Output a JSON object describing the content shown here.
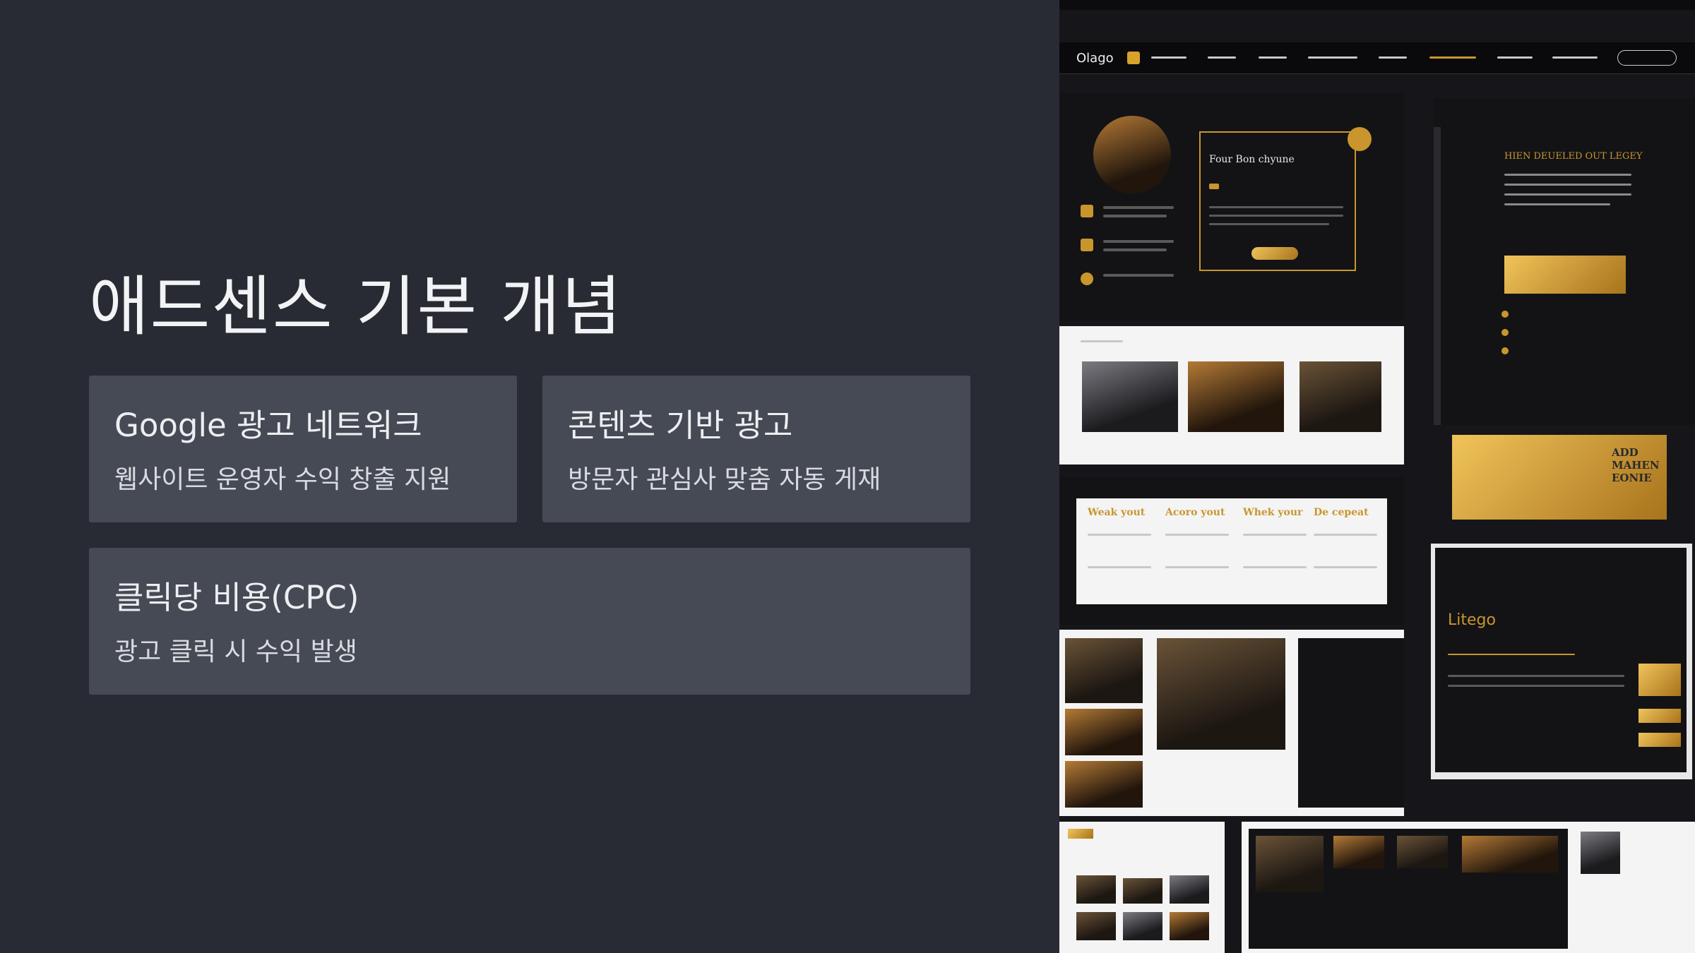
{
  "slide": {
    "title": "애드센스 기본 개념",
    "cards": [
      {
        "title": "Google 광고 네트워크",
        "description": "웹사이트 운영자 수익 창출 지원"
      },
      {
        "title": "콘텐츠 기반 광고",
        "description": "방문자 관심사 맞춤 자동 게재"
      },
      {
        "title": "클릭당 비용(CPC)",
        "description": "광고 클릭 시 수익 발생"
      }
    ]
  },
  "collage": {
    "nav_logo": "Olago",
    "tile_headings": {
      "card_heading": "Four Bon chyune",
      "legacy_heading": "HIEN DEUELED OUT LEGEY",
      "col1": "Weak yout",
      "col2": "Acoro yout",
      "col3": "Whek your",
      "col4": "De cepeat",
      "brand": "Litego",
      "gold_banner": "ADD MAHEN EONIE"
    },
    "colors": {
      "gold": "#c9962d",
      "dark": "#131316",
      "slide_bg": "#282b33",
      "card_bg": "#454a54"
    }
  }
}
